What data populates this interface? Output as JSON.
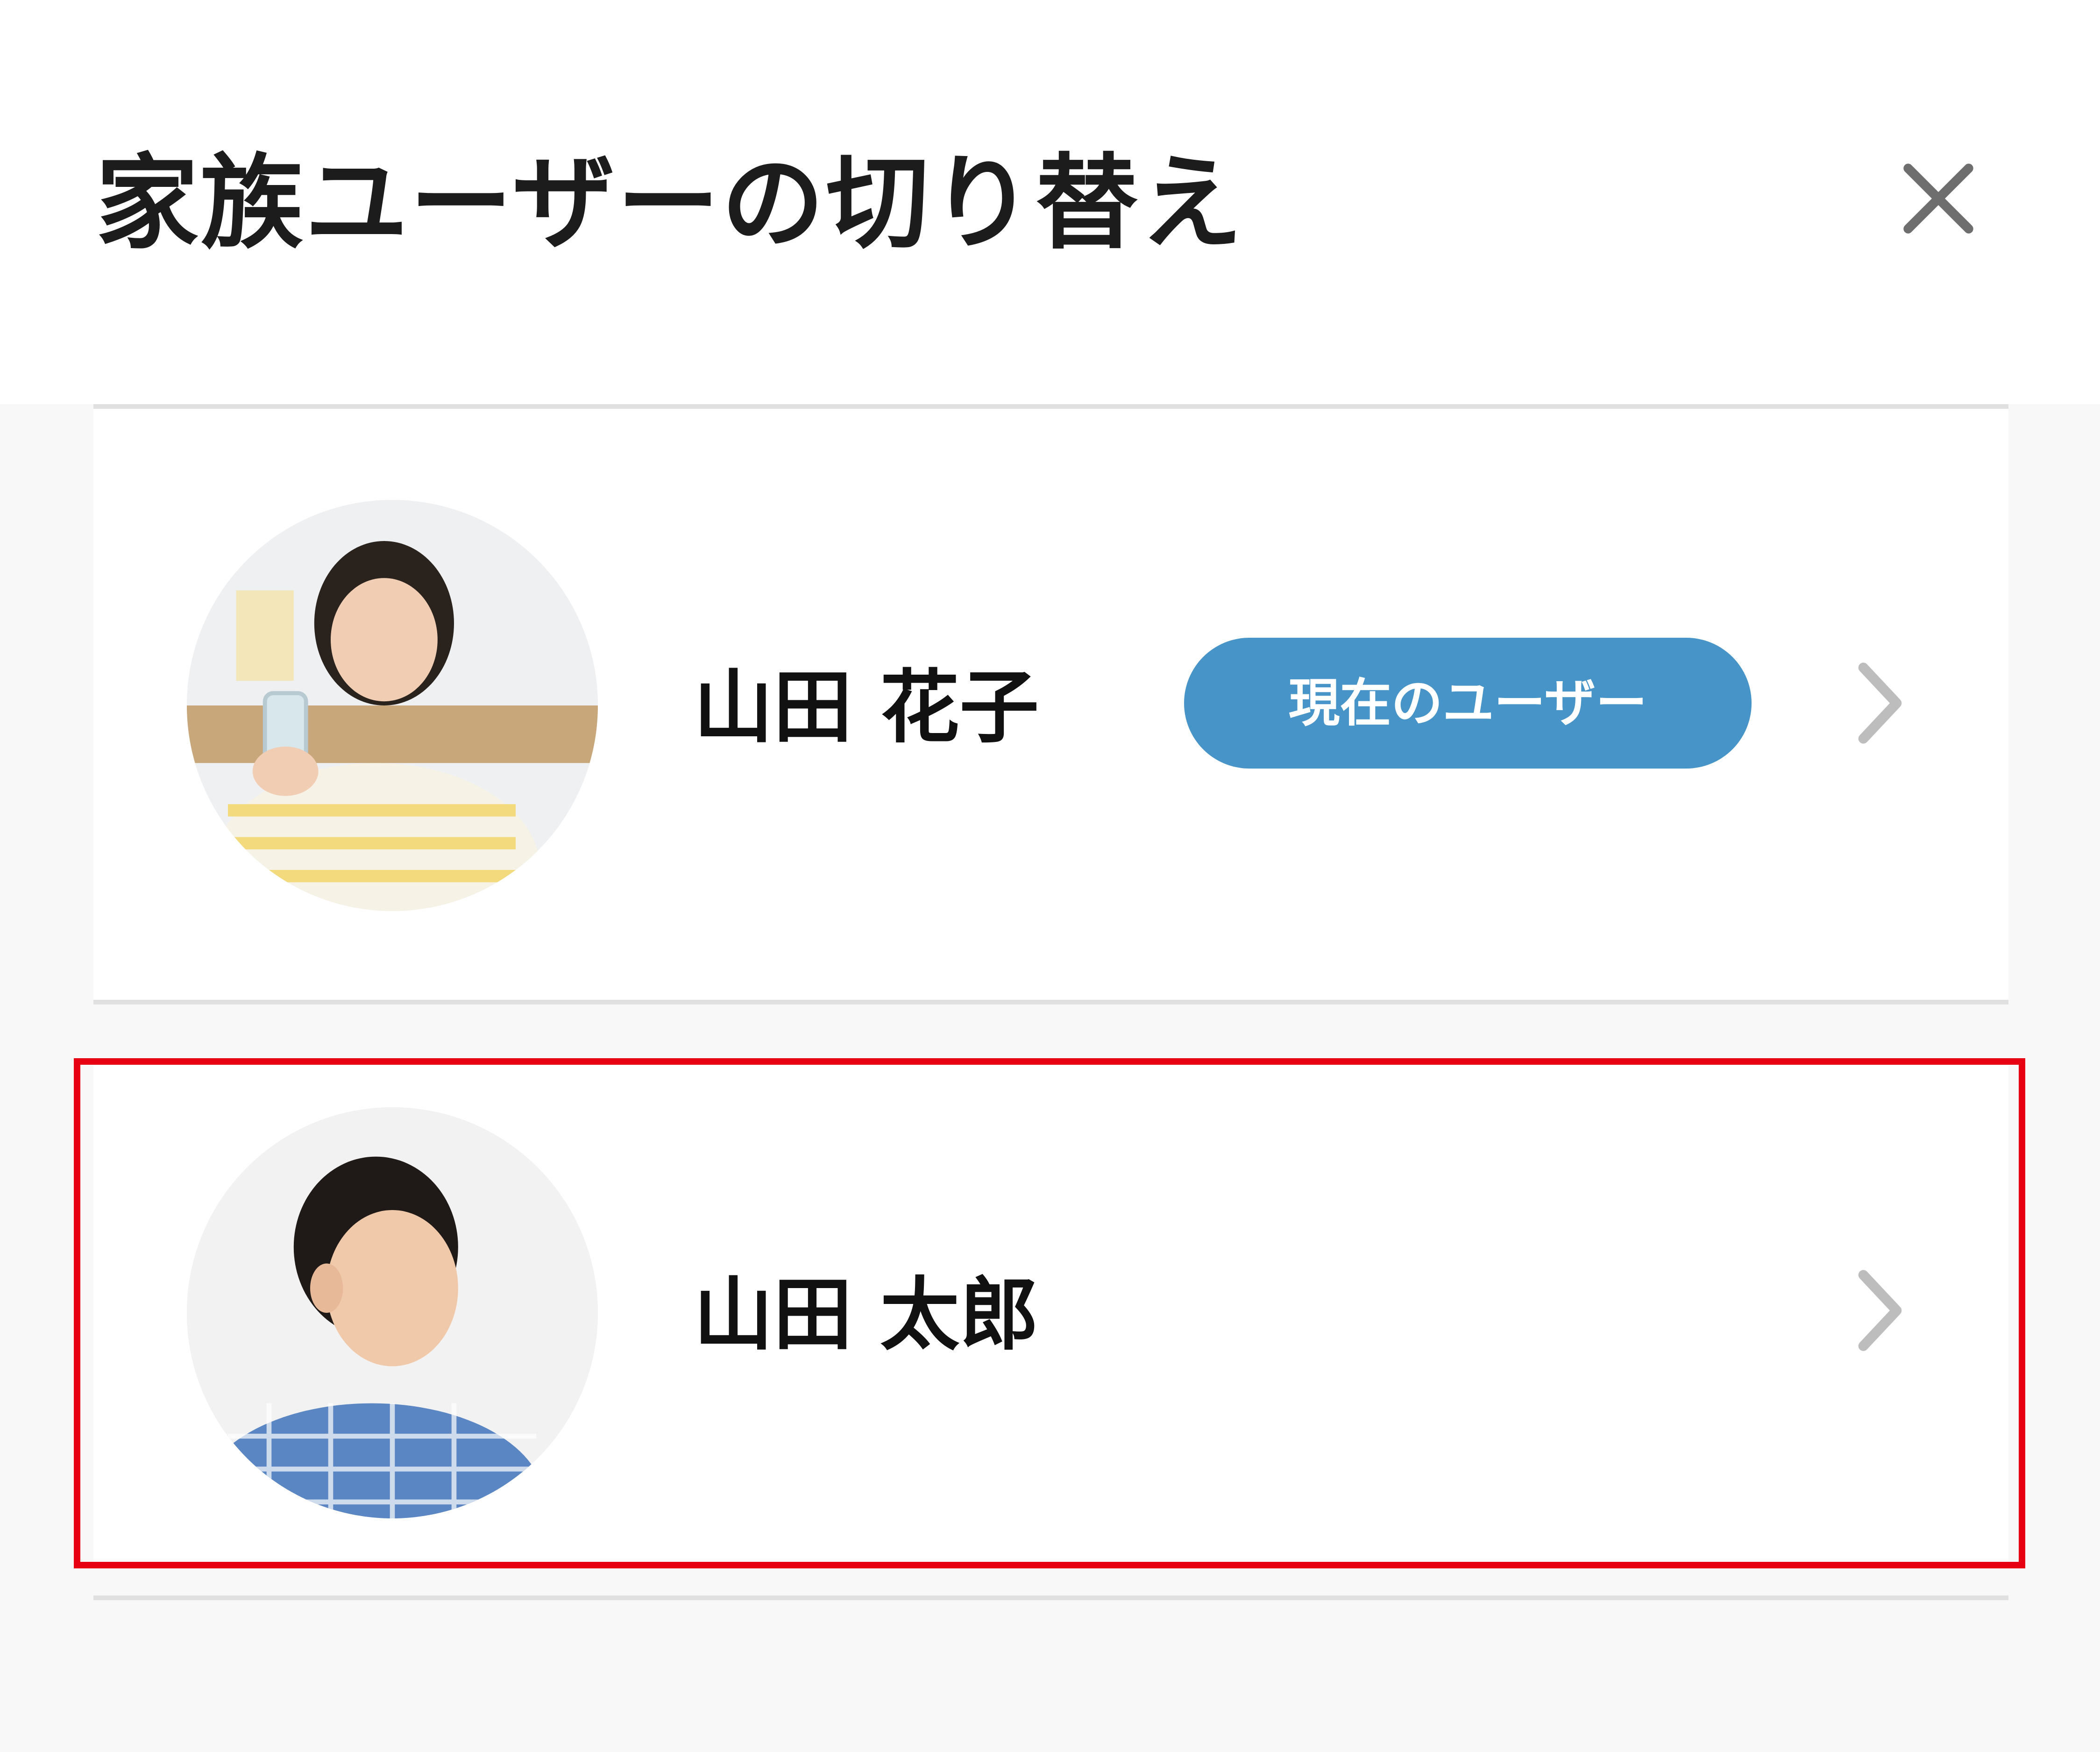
{
  "header": {
    "title": "家族ユーザーの切り替え",
    "close_icon": "close-icon"
  },
  "users": [
    {
      "name": "山田 花子",
      "badge": "現在のユーザー",
      "is_current": true,
      "avatar_icon": "avatar-woman-photo",
      "chevron_icon": "chevron-right-icon"
    },
    {
      "name": "山田 太郎",
      "badge": "",
      "is_current": false,
      "avatar_icon": "avatar-boy-photo",
      "chevron_icon": "chevron-right-icon"
    }
  ],
  "colors": {
    "badge": "#4794c8",
    "highlight": "#e60012",
    "divider": "#e0e0e0",
    "chevron": "#bdbdbd",
    "close": "#6e6e6e"
  }
}
